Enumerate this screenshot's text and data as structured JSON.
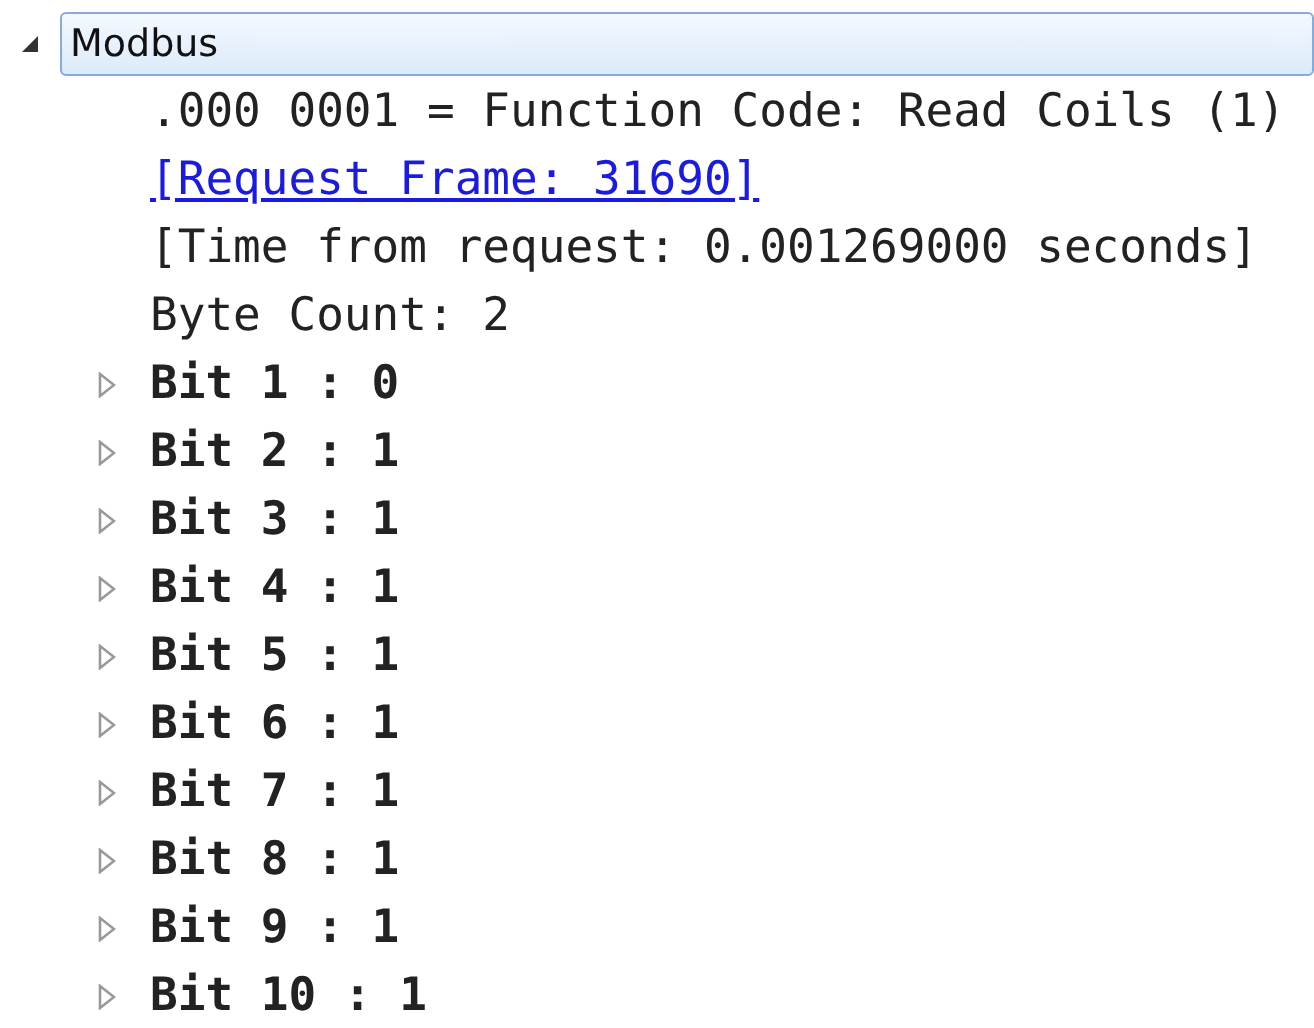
{
  "tree": [
    {
      "label": "Modbus",
      "expanded": true,
      "selected": true,
      "children": [
        {
          "kind": "field",
          "label": ".000 0001 = Function Code: Read Coils (1)"
        },
        {
          "kind": "link",
          "label": "[Request Frame: 31690]"
        },
        {
          "kind": "field",
          "label": "[Time from request: 0.001269000 seconds]"
        },
        {
          "kind": "field",
          "label": "Byte Count: 2"
        },
        {
          "kind": "subtree",
          "label": "Bit 1 : 0",
          "expanded": false
        },
        {
          "kind": "subtree",
          "label": "Bit 2 : 1",
          "expanded": false
        },
        {
          "kind": "subtree",
          "label": "Bit 3 : 1",
          "expanded": false
        },
        {
          "kind": "subtree",
          "label": "Bit 4 : 1",
          "expanded": false
        },
        {
          "kind": "subtree",
          "label": "Bit 5 : 1",
          "expanded": false
        },
        {
          "kind": "subtree",
          "label": "Bit 6 : 1",
          "expanded": false
        },
        {
          "kind": "subtree",
          "label": "Bit 7 : 1",
          "expanded": false
        },
        {
          "kind": "subtree",
          "label": "Bit 8 : 1",
          "expanded": false
        },
        {
          "kind": "subtree",
          "label": "Bit 9 : 1",
          "expanded": false
        },
        {
          "kind": "subtree",
          "label": "Bit 10 : 1",
          "expanded": false
        }
      ]
    }
  ]
}
